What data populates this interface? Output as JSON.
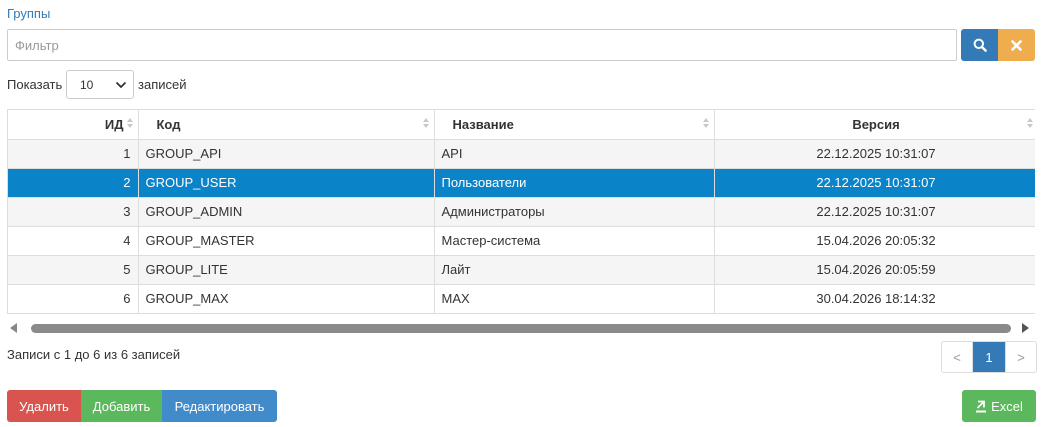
{
  "header": {
    "title": "Группы"
  },
  "filter": {
    "placeholder": "Фильтр",
    "search_icon": "search-icon",
    "clear_icon": "close-icon"
  },
  "length": {
    "show_label": "Показать",
    "selected": "10",
    "entries_label": "записей"
  },
  "table": {
    "columns": [
      "ИД",
      "Код",
      "Название",
      "Версия"
    ],
    "rows": [
      {
        "id": "1",
        "code": "GROUP_API",
        "name": "API",
        "version": "22.12.2025 10:31:07",
        "selected": false
      },
      {
        "id": "2",
        "code": "GROUP_USER",
        "name": "Пользователи",
        "version": "22.12.2025 10:31:07",
        "selected": true
      },
      {
        "id": "3",
        "code": "GROUP_ADMIN",
        "name": "Администраторы",
        "version": "22.12.2025 10:31:07",
        "selected": false
      },
      {
        "id": "4",
        "code": "GROUP_MASTER",
        "name": "Мастер-система",
        "version": "15.04.2026 20:05:32",
        "selected": false
      },
      {
        "id": "5",
        "code": "GROUP_LITE",
        "name": "Лайт",
        "version": "15.04.2026 20:05:59",
        "selected": false
      },
      {
        "id": "6",
        "code": "GROUP_MAX",
        "name": "MAX",
        "version": "30.04.2026 18:14:32",
        "selected": false
      }
    ]
  },
  "info": {
    "text": "Записи с 1 до 6 из 6 записей"
  },
  "pager": {
    "prev": "<",
    "current": "1",
    "next": ">"
  },
  "actions": {
    "delete": "Удалить",
    "add": "Добавить",
    "edit": "Редактировать",
    "excel": "Excel"
  },
  "colors": {
    "primary": "#337ab7",
    "warning": "#f0ad4e",
    "danger": "#d9534f",
    "success": "#5cb85c",
    "selected_row": "#0a83c9"
  }
}
